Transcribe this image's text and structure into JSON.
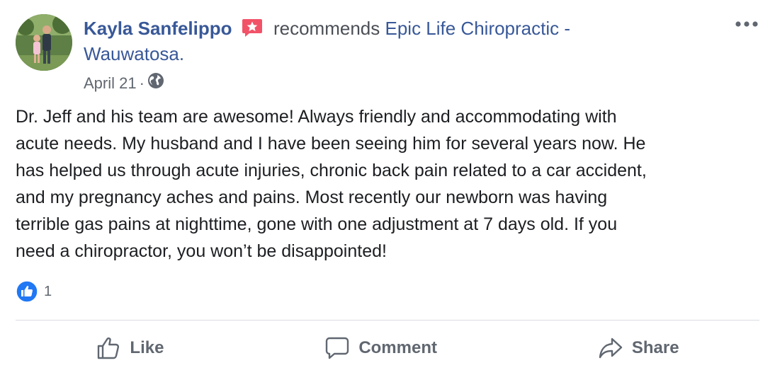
{
  "post": {
    "author": "Kayla Sanfelippo",
    "recommends_text": "recommends",
    "page_name": "Epic Life Chiropractic - Wauwatosa.",
    "date": "April 21",
    "separator": "·",
    "body": "Dr. Jeff and his team are awesome! Always friendly and accommodating with\nacute needs. My husband and I have been seeing him for several years now. He\nhas helped us through acute injuries, chronic back pain related to a car accident,\nand my pregnancy aches and pains. Most recently our newborn was having\nterrible gas pains at nighttime, gone with one adjustment at 7 days old. If you\nneed a chiropractor, you won’t be disappointed!",
    "reaction_count": "1"
  },
  "actions": {
    "like": "Like",
    "comment": "Comment",
    "share": "Share"
  },
  "icons": {
    "recommendation_badge": "star-badge-icon",
    "privacy": "globe-icon",
    "more": "ellipsis-icon",
    "reaction": "like-reaction-icon"
  },
  "colors": {
    "link": "#385898",
    "badge": "#f25268",
    "reaction": "#2078f4"
  }
}
